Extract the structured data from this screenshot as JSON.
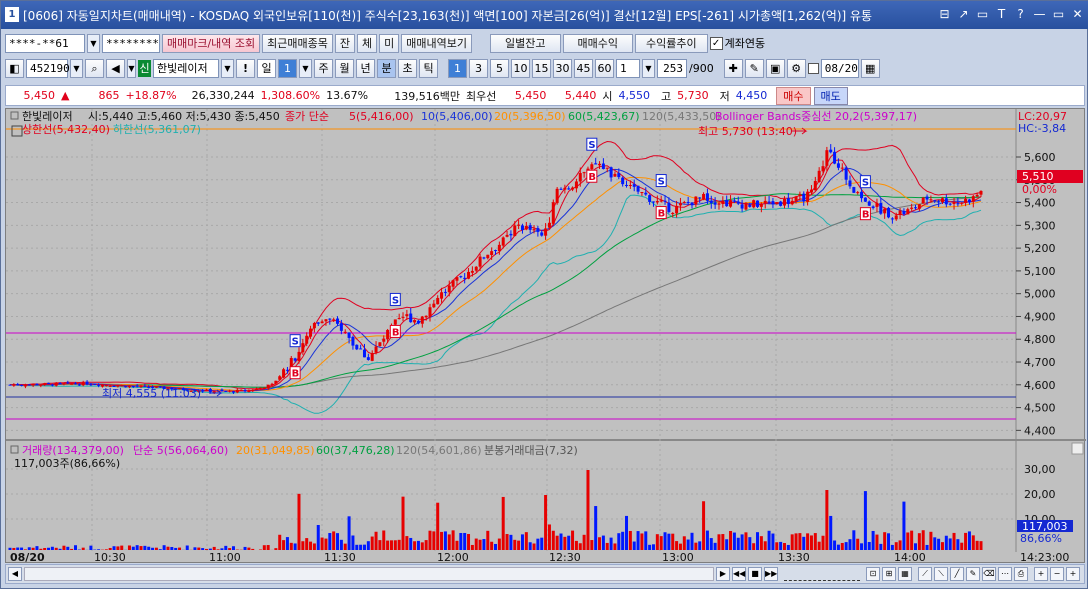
{
  "window": {
    "num": "1",
    "title": "[0606] 자동일지차트(매매내역) - KOSDAQ 외국인보유[110(천)] 주식수[23,163(천)] 액면[100] 자본금[26(억)] 결산[12월] EPS[-261] 시가총액[1,262(억)] 유통",
    "buttons": [
      "⊟",
      "↗",
      "▭",
      "T",
      "?",
      "—",
      "▭",
      "✕"
    ]
  },
  "toolbar1": {
    "account": "****-**61",
    "password": "********",
    "btn_mark": "매매마크/내역 조회",
    "btn_recent": "최근매매종목",
    "btn_jan": "잔",
    "btn_che": "체",
    "btn_mi": "미",
    "btn_history": "매매내역보기",
    "btn_daily": "일별잔고",
    "btn_profit": "매매수익",
    "btn_rate": "수익률추이",
    "chk_link": "계좌연동"
  },
  "toolbar2": {
    "code": "452190",
    "badge": "신",
    "name": "한빛레이저",
    "excl": "!",
    "period": "일",
    "period_n": "1",
    "p_week": "주",
    "p_month": "월",
    "p_year": "년",
    "p_min": "분",
    "p_sec": "초",
    "p_tick": "틱",
    "intervals": [
      "1",
      "3",
      "5",
      "10",
      "15",
      "30",
      "45",
      "60"
    ],
    "sel_n": "1",
    "count": "253",
    "total": "/900",
    "date": "08/20"
  },
  "pricebar": {
    "price": "5,450",
    "arrow": "▲",
    "change": "865",
    "pct": "+18.87%",
    "volume": "26,330,244",
    "vol_pct": "1,308.60%",
    "turnover": "13.67%",
    "amount": "139,516백만",
    "bid_label": "최우선",
    "ask": "5,450",
    "bid": "5,440",
    "open_lbl": "시",
    "open": "4,550",
    "high_lbl": "고",
    "high": "5,730",
    "low_lbl": "저",
    "low": "4,450",
    "buy": "매수",
    "sell": "매도"
  },
  "chart": {
    "legend1": {
      "name": "한빛레이저",
      "ohlc": "시:5,440 고:5,460 저:5,430 종:5,450",
      "ma_label": "종가 단순",
      "ma5": "5(5,416,00)",
      "ma10": "10(5,406,00)",
      "ma20": "20(5,396,50)",
      "ma60": "60(5,423,67)",
      "ma120": "120(5,433,50)",
      "bb": "Bollinger Bands중심선 20,2(5,397,17)"
    },
    "legend2": {
      "upper": "상한선(5,432,40)",
      "lower": "하한선(5,361,07)"
    },
    "right_top": {
      "lc": "LC:20,97",
      "hc": "HC:-3,84"
    },
    "annot_high": "최고 5,730 (13:40)",
    "annot_low": "최저 4,555 (11:03)",
    "price_axis": [
      "5,600",
      "5,500",
      "5,400",
      "5,300",
      "5,200",
      "5,100",
      "5,000",
      "4,900",
      "4,800",
      "4,700",
      "4,600",
      "4,500",
      "4,400"
    ],
    "cur_price": "5,510",
    "cur_pct": "0,00%",
    "vol_legend": {
      "vol": "거래량(134,379,00)",
      "ma5": "단순 5(56,064,60)",
      "ma20": "20(31,049,85)",
      "ma60": "60(37,476,28)",
      "ma120": "120(54,601,86)",
      "amt": "분봉거래대금(7,32)",
      "sub": "117,003주(86,66%)"
    },
    "vol_axis": [
      "30,00",
      "20,00",
      "10,00"
    ],
    "vol_cur": "117,003",
    "vol_cur_pct": "86,66%",
    "time_axis": [
      "08/20",
      "10:30",
      "11:00",
      "11:30",
      "12:00",
      "12:30",
      "13:00",
      "13:30",
      "14:00",
      "14:23:00"
    ],
    "colors": {
      "up": "#e60000",
      "down": "#0018ff",
      "ma5": "#e00020",
      "ma10": "#1a34d8",
      "ma20": "#ff9000",
      "ma60": "#00a040",
      "ma120": "#777777",
      "bb": "#cc00cc"
    }
  }
}
